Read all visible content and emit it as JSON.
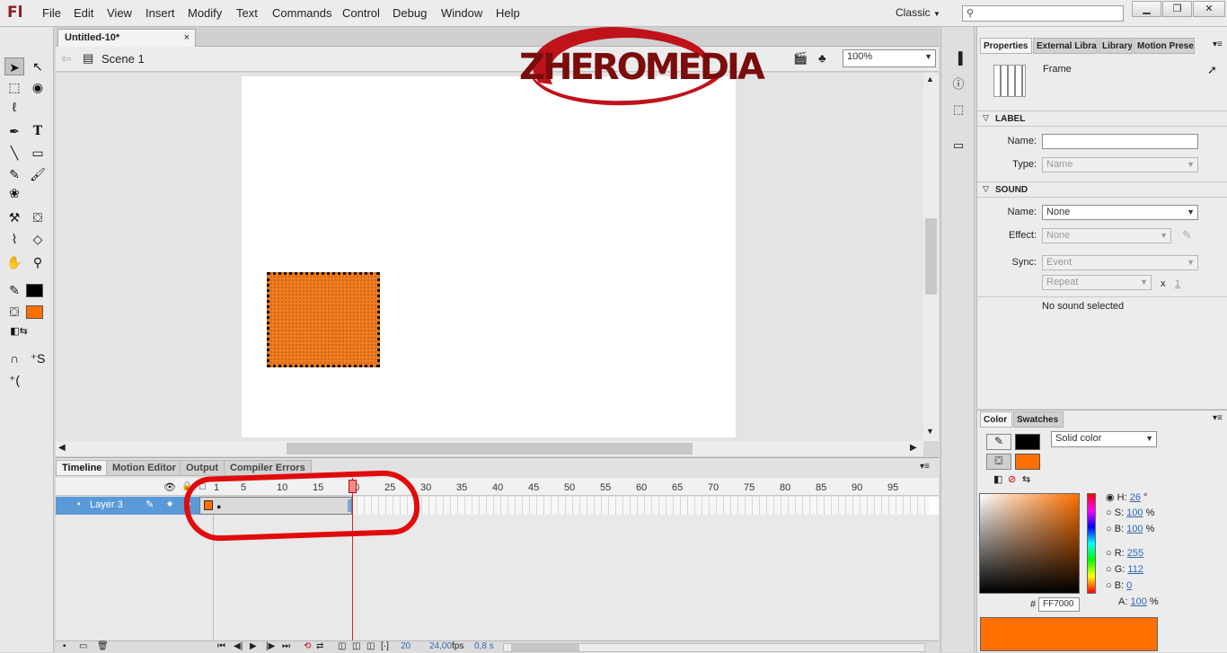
{
  "app": {
    "logo": "Fl",
    "workspace": "Classic",
    "win_minimize": "▁",
    "win_restore": "❐",
    "win_close": "✕"
  },
  "menu": [
    "File",
    "Edit",
    "View",
    "Insert",
    "Modify",
    "Text",
    "Commands",
    "Control",
    "Debug",
    "Window",
    "Help"
  ],
  "doc": {
    "tab_title": "Untitled-10*",
    "close": "×",
    "scene": "Scene 1",
    "zoom": "100%"
  },
  "watermark": {
    "text": "ZHEROMEDIA",
    "ring_color": "#c0121a",
    "text_color": "#7a0c0c"
  },
  "stage": {
    "rect_color": "#ee7d22"
  },
  "timeline": {
    "tabs": [
      "Timeline",
      "Motion Editor",
      "Output",
      "Compiler Errors"
    ],
    "ruler": [
      "1",
      "5",
      "10",
      "15",
      "20",
      "25",
      "30",
      "35",
      "40",
      "45",
      "50",
      "55",
      "60",
      "65",
      "70",
      "75",
      "80",
      "85",
      "90",
      "95"
    ],
    "layer": "Layer 3",
    "footer": {
      "frame": "20",
      "fps": "24,00",
      "fps_unit": "fps",
      "time": "0,8 s"
    }
  },
  "properties": {
    "tabs": [
      "Properties",
      "External Libra",
      "Library",
      "Motion Prese"
    ],
    "kind": "Frame",
    "label_section": "LABEL",
    "name_label": "Name:",
    "type_label": "Type:",
    "type_value": "Name",
    "sound_section": "SOUND",
    "sound_name_label": "Name:",
    "sound_name_value": "None",
    "effect_label": "Effect:",
    "effect_value": "None",
    "sync_label": "Sync:",
    "sync_value": "Event",
    "repeat_value": "Repeat",
    "repeat_x": "x",
    "repeat_count": "1",
    "status": "No sound selected"
  },
  "color": {
    "tabs": [
      "Color",
      "Swatches"
    ],
    "fill_type": "Solid color",
    "stroke_color": "#000000",
    "fill_color": "#ff7000",
    "H_label": "H:",
    "H": "26",
    "H_unit": "°",
    "S_label": "S:",
    "S": "100",
    "S_unit": "%",
    "B_label": "B:",
    "B": "100",
    "B_unit": "%",
    "R_label": "R:",
    "R": "255",
    "G_label": "G:",
    "G": "112",
    "B2_label": "B:",
    "B2": "0",
    "A_label": "A:",
    "A": "100",
    "A_unit": "%",
    "hex_prefix": "#",
    "hex": "FF7000"
  },
  "icons": [
    "arrow-tool",
    "subselect-tool",
    "free-transform-tool",
    "3d-rotation-tool",
    "lasso-tool",
    "pen-tool",
    "text-tool",
    "line-tool",
    "rectangle-tool",
    "pencil-tool",
    "brush-tool",
    "deco-tool",
    "bone-tool",
    "paint-bucket-tool",
    "eyedropper-tool",
    "eraser-tool",
    "hand-tool",
    "zoom-tool",
    "snap-icon",
    "smooth-icon",
    "straighten-icon"
  ]
}
